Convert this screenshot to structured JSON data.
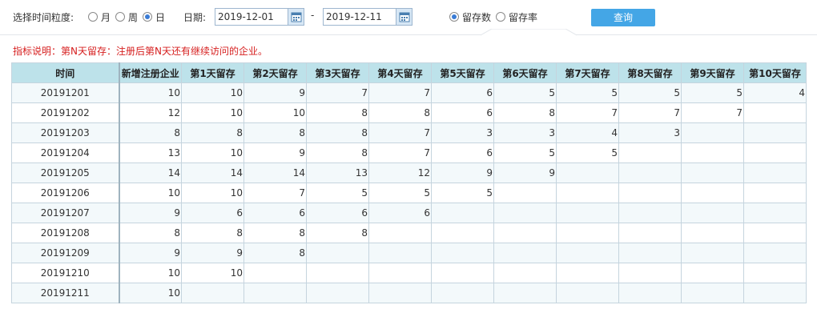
{
  "filter": {
    "granularity_label": "选择时间粒度:",
    "granularity_options": [
      {
        "label": "月",
        "checked": false
      },
      {
        "label": "周",
        "checked": false
      },
      {
        "label": "日",
        "checked": true
      }
    ],
    "date_label": "日期:",
    "start_date": "2019-12-01",
    "range_separator": "-",
    "end_date": "2019-12-11",
    "metric_options": [
      {
        "label": "留存数",
        "checked": true
      },
      {
        "label": "留存率",
        "checked": false
      }
    ],
    "query_label": "查询"
  },
  "note": "指标说明：第N天留存：注册后第N天还有继续访问的企业。",
  "colors": {
    "accent": "#44a6e6",
    "header_bg": "#bde2ea",
    "note_red": "#d61f1f"
  },
  "table": {
    "headers": [
      "时间",
      "新增注册企业",
      "第1天留存",
      "第2天留存",
      "第3天留存",
      "第4天留存",
      "第5天留存",
      "第6天留存",
      "第7天留存",
      "第8天留存",
      "第9天留存",
      "第10天留存"
    ],
    "rows": [
      [
        "20191201",
        "10",
        "10",
        "9",
        "7",
        "7",
        "6",
        "5",
        "5",
        "5",
        "5",
        "4"
      ],
      [
        "20191202",
        "12",
        "10",
        "10",
        "8",
        "8",
        "6",
        "8",
        "7",
        "7",
        "7",
        ""
      ],
      [
        "20191203",
        "8",
        "8",
        "8",
        "8",
        "7",
        "3",
        "3",
        "4",
        "3",
        "",
        ""
      ],
      [
        "20191204",
        "13",
        "10",
        "9",
        "8",
        "7",
        "6",
        "5",
        "5",
        "",
        "",
        ""
      ],
      [
        "20191205",
        "14",
        "14",
        "14",
        "13",
        "12",
        "9",
        "9",
        "",
        "",
        "",
        ""
      ],
      [
        "20191206",
        "10",
        "10",
        "7",
        "5",
        "5",
        "5",
        "",
        "",
        "",
        "",
        ""
      ],
      [
        "20191207",
        "9",
        "6",
        "6",
        "6",
        "6",
        "",
        "",
        "",
        "",
        "",
        ""
      ],
      [
        "20191208",
        "8",
        "8",
        "8",
        "8",
        "",
        "",
        "",
        "",
        "",
        "",
        ""
      ],
      [
        "20191209",
        "9",
        "9",
        "8",
        "",
        "",
        "",
        "",
        "",
        "",
        "",
        ""
      ],
      [
        "20191210",
        "10",
        "10",
        "",
        "",
        "",
        "",
        "",
        "",
        "",
        "",
        ""
      ],
      [
        "20191211",
        "10",
        "",
        "",
        "",
        "",
        "",
        "",
        "",
        "",
        "",
        ""
      ]
    ]
  }
}
